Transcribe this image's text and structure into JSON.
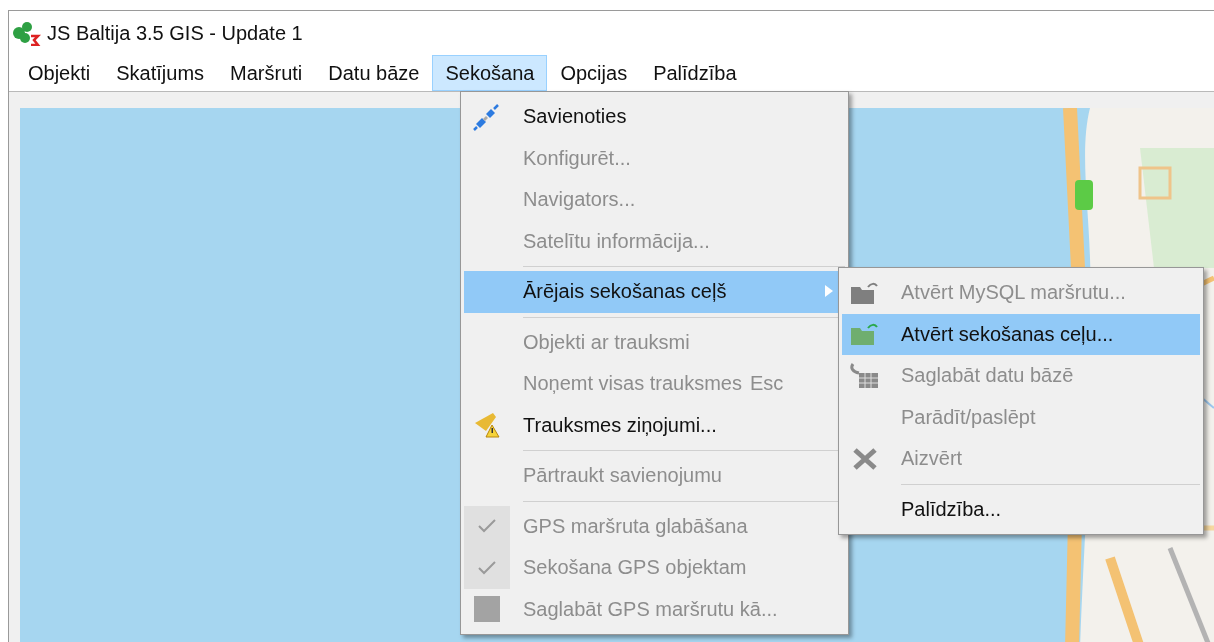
{
  "window": {
    "title": "JS Baltija 3.5 GIS - Update 1"
  },
  "menubar": [
    {
      "label": "Objekti",
      "selected": false
    },
    {
      "label": "Skatījums",
      "selected": false
    },
    {
      "label": "Maršruti",
      "selected": false
    },
    {
      "label": "Datu bāze",
      "selected": false
    },
    {
      "label": "Sekošana",
      "selected": true
    },
    {
      "label": "Opcijas",
      "selected": false
    },
    {
      "label": "Palīdzība",
      "selected": false
    }
  ],
  "menu": [
    {
      "kind": "item",
      "label": "Savienoties",
      "disabled": false,
      "selected": false
    },
    {
      "kind": "item",
      "label": "Konfigurēt...",
      "disabled": true,
      "selected": false
    },
    {
      "kind": "item",
      "label": "Navigators...",
      "disabled": true,
      "selected": false
    },
    {
      "kind": "item",
      "label": "Satelītu informācija...",
      "disabled": true,
      "selected": false
    },
    {
      "kind": "separator"
    },
    {
      "kind": "submenu",
      "label": "Ārējais sekošanas ceļš",
      "disabled": false,
      "selected": true
    },
    {
      "kind": "separator"
    },
    {
      "kind": "item",
      "label": "Objekti ar trauksmi",
      "disabled": true,
      "selected": false
    },
    {
      "kind": "item",
      "label": "Noņemt visas trauksmes",
      "shortcut": "Esc",
      "disabled": true,
      "selected": false
    },
    {
      "kind": "item",
      "label": "Trauksmes ziņojumi...",
      "disabled": false,
      "selected": false
    },
    {
      "kind": "separator"
    },
    {
      "kind": "item",
      "label": "Pārtraukt savienojumu",
      "disabled": true,
      "selected": false
    },
    {
      "kind": "separator"
    },
    {
      "kind": "check",
      "label": "GPS maršruta glabāšana",
      "checked": true,
      "disabled": true,
      "selected": false
    },
    {
      "kind": "check",
      "label": "Sekošana GPS objektam",
      "checked": true,
      "disabled": true,
      "selected": false
    },
    {
      "kind": "item",
      "label": "Saglabāt GPS maršrutu kā...",
      "disabled": true,
      "selected": false
    }
  ],
  "submenu": [
    {
      "kind": "item",
      "label": "Atvērt MySQL maršrutu...",
      "disabled": true,
      "selected": false
    },
    {
      "kind": "item",
      "label": "Atvērt sekošanas ceļu...",
      "disabled": false,
      "selected": true
    },
    {
      "kind": "item",
      "label": "Saglabāt datu bāzē",
      "disabled": true,
      "selected": false
    },
    {
      "kind": "item",
      "label": "Parādīt/paslēpt",
      "disabled": true,
      "selected": false
    },
    {
      "kind": "item",
      "label": "Aizvērt",
      "disabled": true,
      "selected": false
    },
    {
      "kind": "separator"
    },
    {
      "kind": "item",
      "label": "Palīdzība...",
      "disabled": false,
      "selected": false
    }
  ]
}
